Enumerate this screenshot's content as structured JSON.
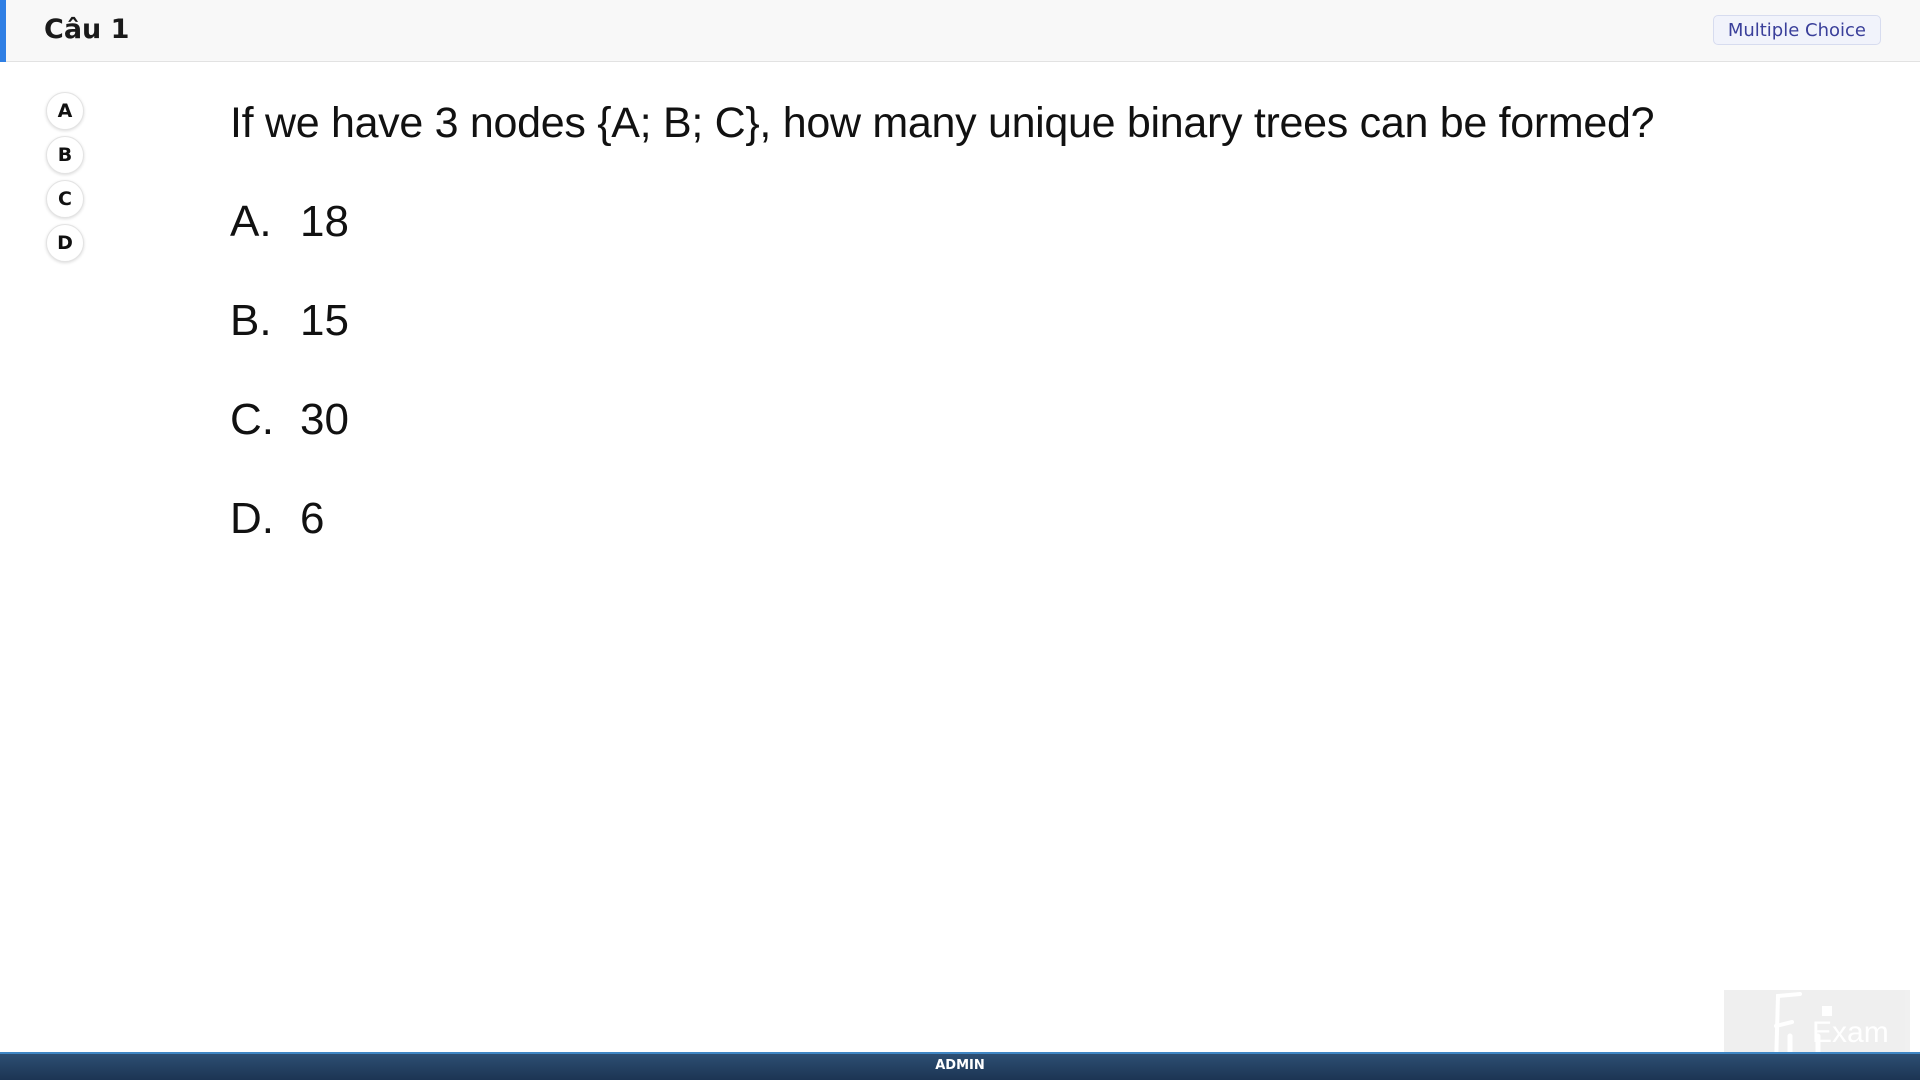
{
  "header": {
    "title": "Câu 1",
    "question_type": "Multiple Choice"
  },
  "answer_picker": {
    "options": [
      "A",
      "B",
      "C",
      "D"
    ]
  },
  "question": {
    "text": "If we have 3 nodes {A; B; C}, how many unique binary trees can be formed?",
    "options": [
      {
        "letter": "A.",
        "value": "18"
      },
      {
        "letter": "B.",
        "value": "15"
      },
      {
        "letter": "C.",
        "value": "30"
      },
      {
        "letter": "D.",
        "value": "6"
      }
    ]
  },
  "logo": {
    "text": "Exam",
    "icon": "fu-exam-logo-icon"
  },
  "footer": {
    "label": "ADMIN"
  },
  "colors": {
    "accent": "#2f7fe4",
    "footer": "#1c3553",
    "badge_text": "#3a3f9a"
  }
}
